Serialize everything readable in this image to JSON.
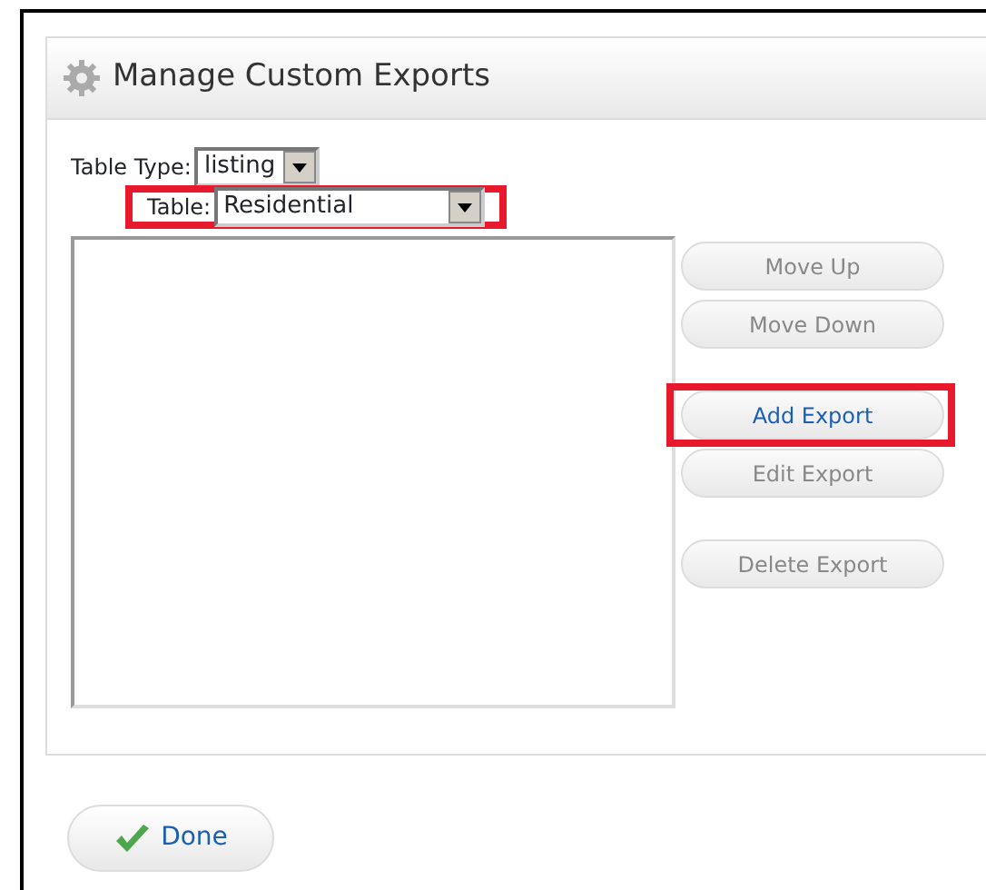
{
  "panel": {
    "title": "Manage Custom Exports",
    "filters": [
      {
        "label": "Table Type:",
        "value": "listing",
        "highlighted": false
      },
      {
        "label": "Table:",
        "value": "Residential",
        "highlighted": true
      }
    ],
    "button_groups": [
      {
        "buttons": [
          {
            "label": "Move Up",
            "disabled": true,
            "highlighted": false
          },
          {
            "label": "Move Down",
            "disabled": true,
            "highlighted": false
          }
        ]
      },
      {
        "buttons": [
          {
            "label": "Add Export",
            "disabled": false,
            "highlighted": true
          },
          {
            "label": "Edit Export",
            "disabled": true,
            "highlighted": false
          }
        ]
      },
      {
        "buttons": [
          {
            "label": "Delete Export",
            "disabled": true,
            "highlighted": false
          }
        ]
      }
    ]
  },
  "done_button": {
    "label": "Done"
  }
}
